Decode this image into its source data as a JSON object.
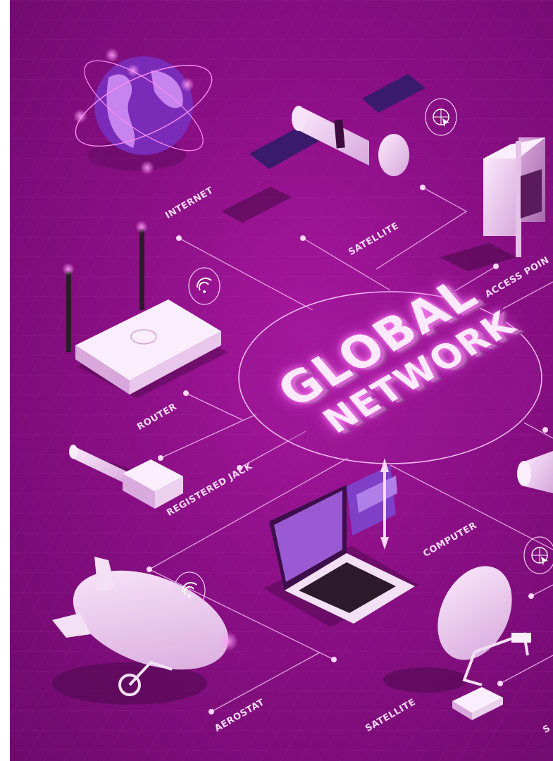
{
  "title": {
    "line1": "GLOBAL",
    "line2": "NETWORK"
  },
  "labels": {
    "internet": "INTERNET",
    "satellite_top": "SATELLITE",
    "access_point": "ACCESS POIN",
    "router": "ROUTER",
    "registered_jack": "REGISTERED JACK",
    "computer": "COMPUTER",
    "aerostat": "AEROSTAT",
    "satellite_bottom": "SATELLITE",
    "edge_bottom_right": "S"
  },
  "colors": {
    "background": "#8a0f85",
    "line": "#e9b3e6",
    "glow": "#ff7cf6",
    "device": "#f2d9f3"
  },
  "icons": [
    "globe-icon",
    "satellite-icon",
    "access-point-icon",
    "router-icon",
    "wifi-icon",
    "cursor-globe-icon",
    "ethernet-jack-icon",
    "laptop-icon",
    "aerostat-icon",
    "satellite-dish-icon"
  ]
}
